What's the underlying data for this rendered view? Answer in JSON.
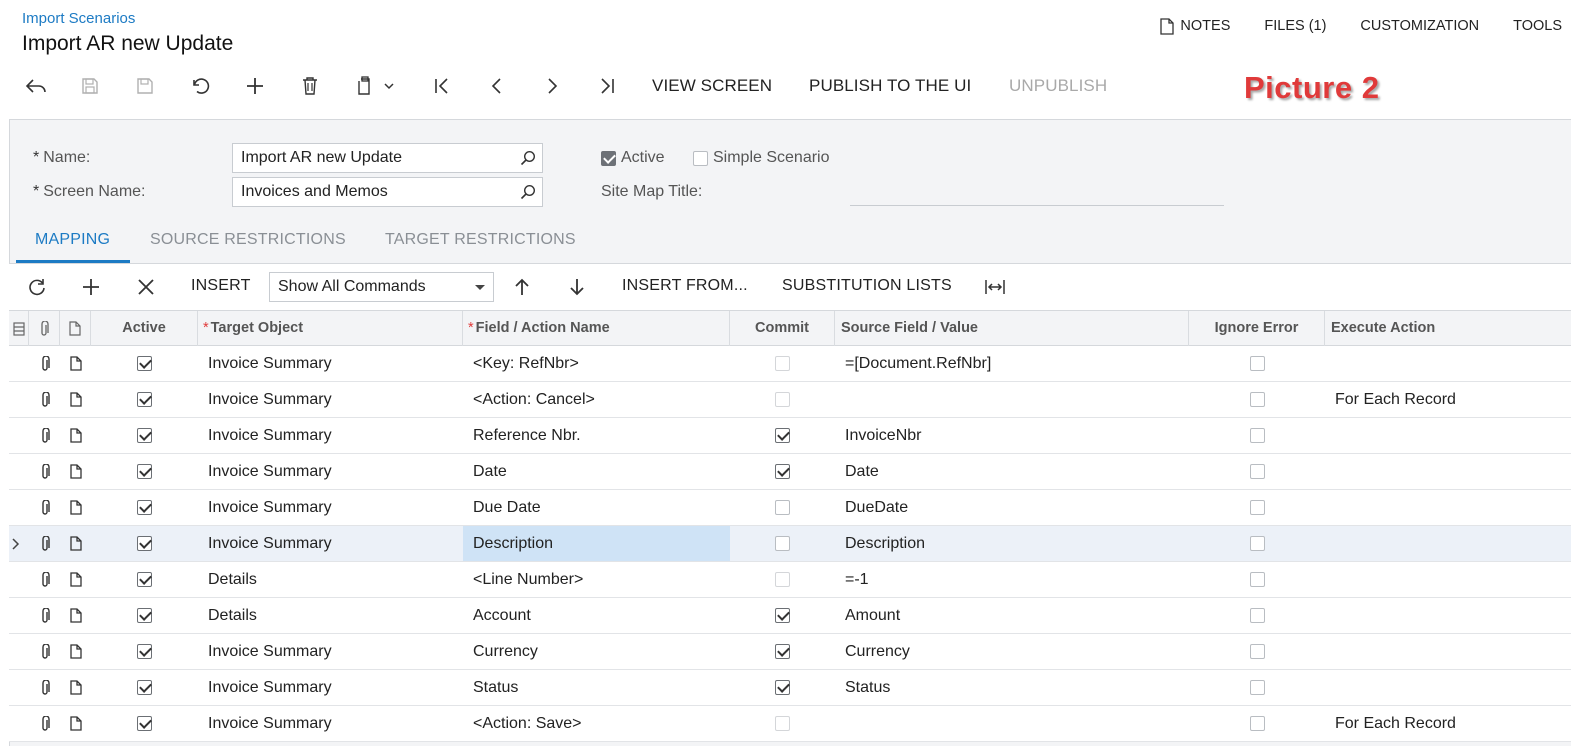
{
  "breadcrumb": "Import Scenarios",
  "title": "Import AR new Update",
  "top_menu": {
    "notes": "NOTES",
    "files": "FILES (1)",
    "customization": "CUSTOMIZATION",
    "tools": "TOOLS"
  },
  "toolbar": {
    "view_screen": "VIEW SCREEN",
    "publish": "PUBLISH TO THE UI",
    "unpublish": "UNPUBLISH"
  },
  "annotation_label": "Picture 2",
  "form": {
    "name_label": "Name:",
    "name_value": "Import AR new Update",
    "screen_name_label": "Screen Name:",
    "screen_name_value": "Invoices and Memos",
    "active_label": "Active",
    "active_checked": true,
    "simple_scenario_label": "Simple Scenario",
    "simple_scenario_checked": false,
    "site_map_title_label": "Site Map Title:",
    "site_map_title_value": ""
  },
  "tabs": {
    "mapping": "MAPPING",
    "source_restrictions": "SOURCE RESTRICTIONS",
    "target_restrictions": "TARGET RESTRICTIONS",
    "active_tab": "MAPPING"
  },
  "grid_toolbar": {
    "insert": "INSERT",
    "command_filter": "Show All Commands",
    "insert_from": "INSERT FROM...",
    "substitution_lists": "SUBSTITUTION LISTS"
  },
  "grid": {
    "columns": {
      "active": "Active",
      "target_object": "Target Object",
      "field_action": "Field / Action Name",
      "commit": "Commit",
      "source_field": "Source Field / Value",
      "ignore_error": "Ignore Error",
      "execute_action": "Execute Action"
    },
    "rows": [
      {
        "active": true,
        "target": "Invoice Summary",
        "field": "<Key: RefNbr>",
        "commit": false,
        "commit_faded": true,
        "source": "=[Document.RefNbr]",
        "ignore_error": false,
        "execute": "",
        "selected": false
      },
      {
        "active": true,
        "target": "Invoice Summary",
        "field": "<Action: Cancel>",
        "commit": false,
        "commit_faded": true,
        "source": "",
        "ignore_error": false,
        "execute": "For Each Record",
        "selected": false
      },
      {
        "active": true,
        "target": "Invoice Summary",
        "field": "Reference Nbr.",
        "commit": true,
        "commit_faded": false,
        "source": "InvoiceNbr",
        "ignore_error": false,
        "execute": "",
        "selected": false
      },
      {
        "active": true,
        "target": "Invoice Summary",
        "field": "Date",
        "commit": true,
        "commit_faded": false,
        "source": "Date",
        "ignore_error": false,
        "execute": "",
        "selected": false
      },
      {
        "active": true,
        "target": "Invoice Summary",
        "field": "Due Date",
        "commit": false,
        "commit_faded": false,
        "source": "DueDate",
        "ignore_error": false,
        "execute": "",
        "selected": false
      },
      {
        "active": true,
        "target": "Invoice Summary",
        "field": "Description",
        "commit": false,
        "commit_faded": false,
        "source": "Description",
        "ignore_error": false,
        "execute": "",
        "selected": true
      },
      {
        "active": true,
        "target": "Details",
        "field": "<Line Number>",
        "commit": false,
        "commit_faded": true,
        "source": "=-1",
        "ignore_error": false,
        "execute": "",
        "selected": false
      },
      {
        "active": true,
        "target": "Details",
        "field": "Account",
        "commit": true,
        "commit_faded": false,
        "source": "Amount",
        "ignore_error": false,
        "execute": "",
        "selected": false
      },
      {
        "active": true,
        "target": "Invoice Summary",
        "field": "Currency",
        "commit": true,
        "commit_faded": false,
        "source": "Currency",
        "ignore_error": false,
        "execute": "",
        "selected": false
      },
      {
        "active": true,
        "target": "Invoice Summary",
        "field": "Status",
        "commit": true,
        "commit_faded": false,
        "source": "Status",
        "ignore_error": false,
        "execute": "",
        "selected": false
      },
      {
        "active": true,
        "target": "Invoice Summary",
        "field": "<Action: Save>",
        "commit": false,
        "commit_faded": true,
        "source": "",
        "ignore_error": false,
        "execute": "For Each Record",
        "selected": false
      }
    ]
  },
  "colors": {
    "accent": "#1d7bc4",
    "annotation": "#e03a3a",
    "selected_row": "#ecf1f8",
    "selected_cell": "#cfe3f6"
  }
}
